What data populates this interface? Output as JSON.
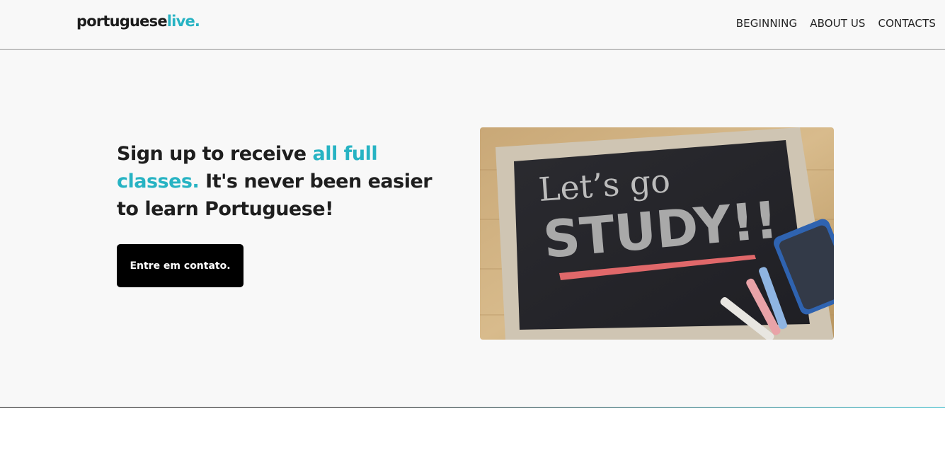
{
  "header": {
    "logo": {
      "main": "portuguese",
      "accent": "live."
    },
    "nav": [
      {
        "label": "BEGINNING"
      },
      {
        "label": "ABOUT US"
      },
      {
        "label": "CONTACTS"
      }
    ]
  },
  "hero": {
    "title_part1": "Sign up to receive ",
    "title_accent": "all full classes.",
    "title_part2": " It's never been easier to learn Portuguese!",
    "cta_label": "Entre em contato.",
    "image": {
      "line1": "Let’s go",
      "line2": "STUDY!!"
    }
  },
  "colors": {
    "accent": "#27b3c3",
    "text": "#1e1e1e",
    "background": "#f8f8f8",
    "button": "#000000"
  }
}
